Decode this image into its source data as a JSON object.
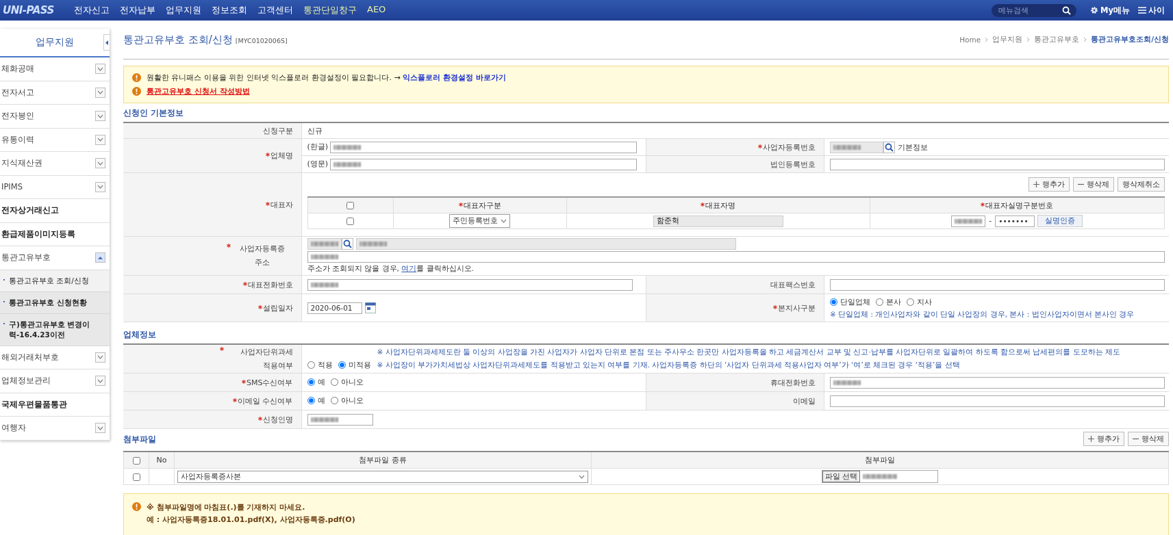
{
  "header": {
    "logo": "UNI-PASS",
    "nav": [
      {
        "label": "전자신고",
        "highlighted": false
      },
      {
        "label": "전자납부",
        "highlighted": false
      },
      {
        "label": "업무지원",
        "highlighted": false
      },
      {
        "label": "정보조회",
        "highlighted": false
      },
      {
        "label": "고객센터",
        "highlighted": false
      },
      {
        "label": "통관단일창구",
        "highlighted": true
      },
      {
        "label": "AEO",
        "highlighted": true
      }
    ],
    "search": {
      "placeholder": "메뉴검색"
    },
    "my_menu": "My메뉴",
    "sitemap": "사이"
  },
  "sidebar": {
    "title": "업무지원",
    "items": [
      {
        "label": "체화공매",
        "kind": "folder",
        "expanded": false
      },
      {
        "label": "전자서고",
        "kind": "folder",
        "expanded": false
      },
      {
        "label": "전자봉인",
        "kind": "folder",
        "expanded": false
      },
      {
        "label": "유통이력",
        "kind": "folder",
        "expanded": false
      },
      {
        "label": "지식재산권",
        "kind": "folder",
        "expanded": false
      },
      {
        "label": "IPIMS",
        "kind": "folder",
        "expanded": false
      },
      {
        "label": "전자상거래신고",
        "kind": "link"
      },
      {
        "label": "환급제품이미지등록",
        "kind": "link"
      },
      {
        "label": "통관고유부호",
        "kind": "folder",
        "expanded": true,
        "children": [
          {
            "label": "통관고유부호 조회/신청",
            "selected": true
          },
          {
            "label": "통관고유부호 신청현황",
            "selected": false
          },
          {
            "label": "구)통관고유부호 변경이력-16.4.23이전",
            "selected": false
          }
        ]
      },
      {
        "label": "해외거래처부호",
        "kind": "folder",
        "expanded": false
      },
      {
        "label": "업체정보관리",
        "kind": "folder",
        "expanded": false
      },
      {
        "label": "국제우편물품통관",
        "kind": "link"
      },
      {
        "label": "여행자",
        "kind": "folder",
        "expanded": false
      }
    ]
  },
  "page": {
    "title": "통관고유부호 조회/신청",
    "code": "[MYC0102006S]",
    "breadcrumb": [
      {
        "label": "Home",
        "current": false
      },
      {
        "label": "업무지원",
        "current": false
      },
      {
        "label": "통관고유부호",
        "current": false
      },
      {
        "label": "통관고유부호조회/신청",
        "current": true
      }
    ]
  },
  "notice": {
    "items": [
      {
        "kind": "info",
        "text": "원활한 유니패스 이용을 위한 인터넷 익스플로러 환경설정이 필요합니다. →",
        "link": "익스플로러 환경설정 바로가기"
      },
      {
        "kind": "guide",
        "link": "통관고유부호 신청서 작성방법"
      }
    ]
  },
  "applicant": {
    "title": "신청인 기본정보",
    "application_type": {
      "label": "신청구분",
      "value": "신규"
    },
    "company_name": {
      "label": "업체명",
      "required": true,
      "korean": {
        "label": "(한글)",
        "masked": true
      },
      "english": {
        "label": "(영문)",
        "masked": true
      }
    },
    "business_number": {
      "label": "사업자등록번호",
      "required": true,
      "masked": true,
      "note": "기본정보"
    },
    "corporate_number": {
      "label": "법인등록번호",
      "required": false
    },
    "representative": {
      "label": "대표자",
      "required": true,
      "buttons": [
        {
          "kind": "add",
          "label": "행추가"
        },
        {
          "kind": "delete",
          "label": "행삭제"
        },
        {
          "kind": "undo",
          "label": "행삭제취소"
        }
      ],
      "all_checked": false,
      "columns": [
        {
          "label": "대표자구분",
          "required": true
        },
        {
          "label": "대표자명",
          "required": true
        },
        {
          "label": "대표자실명구분번호",
          "required": true
        }
      ],
      "rows": [
        {
          "checked": false,
          "type": "주민등록번호",
          "name": "함준혁",
          "id_first_masked": true,
          "separator": "-",
          "id_second": "•••••••",
          "verify": "실명인증"
        }
      ]
    },
    "address": {
      "label": "사업자등록증 주소",
      "required": true,
      "masked": true,
      "hint": {
        "text": "주소가 조회되지 않을 경우, ",
        "link": "여기",
        "after": "를 클릭하십시오."
      }
    },
    "phone": {
      "label": "대표전화번호",
      "required": true,
      "masked": true
    },
    "fax": {
      "label": "대표팩스번호",
      "required": false
    },
    "founded": {
      "label": "설립일자",
      "required": true,
      "value": "2020-06-01"
    },
    "branch_type": {
      "label": "본지사구분",
      "required": true,
      "options": [
        {
          "label": "단일업체",
          "selected": true
        },
        {
          "label": "본사",
          "selected": false
        },
        {
          "label": "지사",
          "selected": false
        }
      ],
      "note": "※ 단일업체 : 개인사업자와 같이 단일 사업장의 경우, 본사 : 법인사업자이면서 본사인 경우"
    }
  },
  "company": {
    "title": "업체정보",
    "unit_tax": {
      "label": "사업자단위과세 적용여부",
      "required": true,
      "options": [
        {
          "label": "적용",
          "selected": false
        },
        {
          "label": "미적용",
          "selected": true
        }
      ],
      "notes": [
        "※ 사업자단위과세제도란 둘 이상의 사업장을 가진 사업자가 사업자 단위로 본점 또는 주사무소 한곳만 사업자등록을 하고 세금계산서 교부 및 신고·납부를 사업자단위로 일괄하여 하도록 함으로써 납세편의를 도모하는 제도",
        "※ 사업장이 부가가치세법상 사업자단위과세제도를 적용받고 있는지 여부를 기재. 사업자등록증 하단의 ‘사업자 단위과세 적용사업자 여부’가 ‘여’로 체크된 경우 ‘적용’을 선택"
      ]
    },
    "sms": {
      "label": "SMS수신여부",
      "required": true,
      "options": [
        {
          "label": "예",
          "selected": true
        },
        {
          "label": "아니오",
          "selected": false
        }
      ]
    },
    "mobile": {
      "label": "휴대전화번호",
      "required": false,
      "masked": true
    },
    "email_receive": {
      "label": "이메일 수신여부",
      "required": true,
      "options": [
        {
          "label": "예",
          "selected": true
        },
        {
          "label": "아니오",
          "selected": false
        }
      ]
    },
    "email": {
      "label": "이메일",
      "required": false
    },
    "applicant_name": {
      "label": "신청인명",
      "required": true,
      "masked": true
    }
  },
  "attachments": {
    "title": "첨부파일",
    "buttons": [
      {
        "kind": "add",
        "label": "행추가"
      },
      {
        "kind": "delete",
        "label": "행삭제"
      }
    ],
    "all_checked": false,
    "columns": [
      {
        "label": "No"
      },
      {
        "label": "첨부파일 종류"
      },
      {
        "label": "첨부파일"
      }
    ],
    "rows": [
      {
        "checked": false,
        "type": "사업자등록증사본",
        "file_button": "파일 선택",
        "file_masked": true
      }
    ]
  },
  "warning": {
    "lines": [
      "※ 첨부파일명에 마침표(.)를 기재하지 마세요.",
      "예 : 사업자등록증18.01.01.pdf(X), 사업자등록증.pdf(O)"
    ]
  }
}
